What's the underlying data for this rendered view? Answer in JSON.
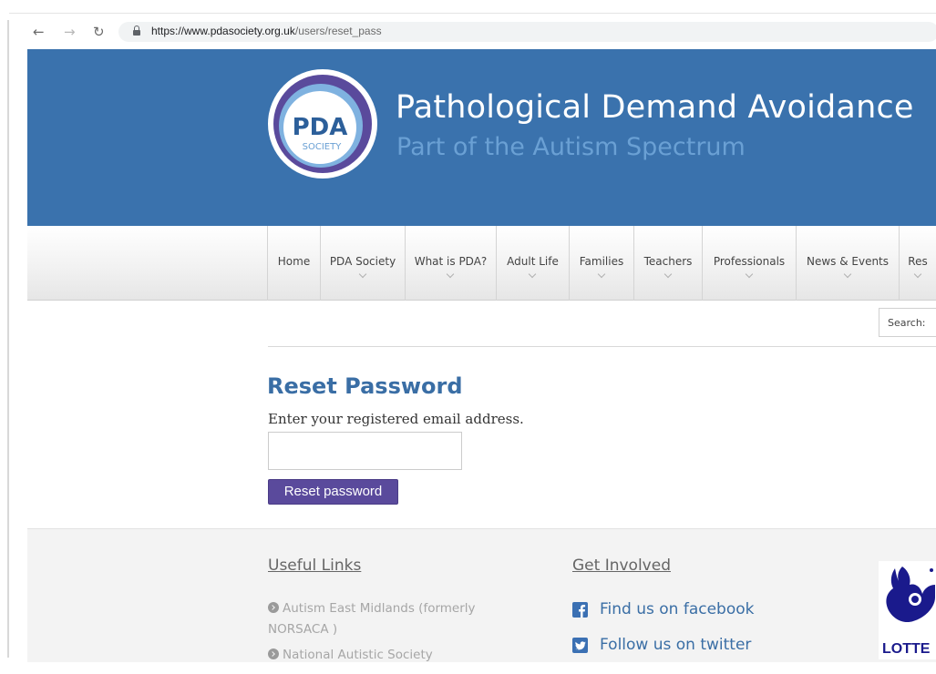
{
  "browser": {
    "nav": {
      "back": "←",
      "forward": "→",
      "reload": "↻"
    },
    "url_host": "https://www.pdasociety.org.uk",
    "url_path": "/users/reset_pass"
  },
  "header": {
    "logo": {
      "main": "PDA",
      "sub": "SOCIETY"
    },
    "title": "Pathological Demand Avoidance",
    "subtitle": "Part of the Autism Spectrum",
    "colors": {
      "banner": "#3a72ad",
      "subtitle": "#6aa0d4",
      "logo_ring": "#5a4a9c"
    }
  },
  "nav": {
    "items": [
      {
        "label": "Home",
        "dropdown": false
      },
      {
        "label": "PDA Society",
        "dropdown": true
      },
      {
        "label": "What is PDA?",
        "dropdown": true
      },
      {
        "label": "Adult Life",
        "dropdown": true
      },
      {
        "label": "Families",
        "dropdown": true
      },
      {
        "label": "Teachers",
        "dropdown": true
      },
      {
        "label": "Professionals",
        "dropdown": true
      },
      {
        "label": "News & Events",
        "dropdown": true
      },
      {
        "label": "Res",
        "dropdown": true
      }
    ]
  },
  "search": {
    "label": "Search:"
  },
  "main": {
    "title": "Reset Password",
    "instructions": "Enter your registered email address.",
    "email_value": "",
    "button_label": "Reset password",
    "colors": {
      "title": "#3a6ea5",
      "button": "#5a4a9c"
    }
  },
  "footer": {
    "useful_links": {
      "heading": "Useful Links",
      "items": [
        "Autism East Midlands (formerly NORSACA )",
        "National Autistic Society"
      ]
    },
    "get_involved": {
      "heading": "Get Involved",
      "facebook": "Find us on facebook",
      "twitter": "Follow us on twitter"
    },
    "lottery_text": "LOTTE"
  }
}
